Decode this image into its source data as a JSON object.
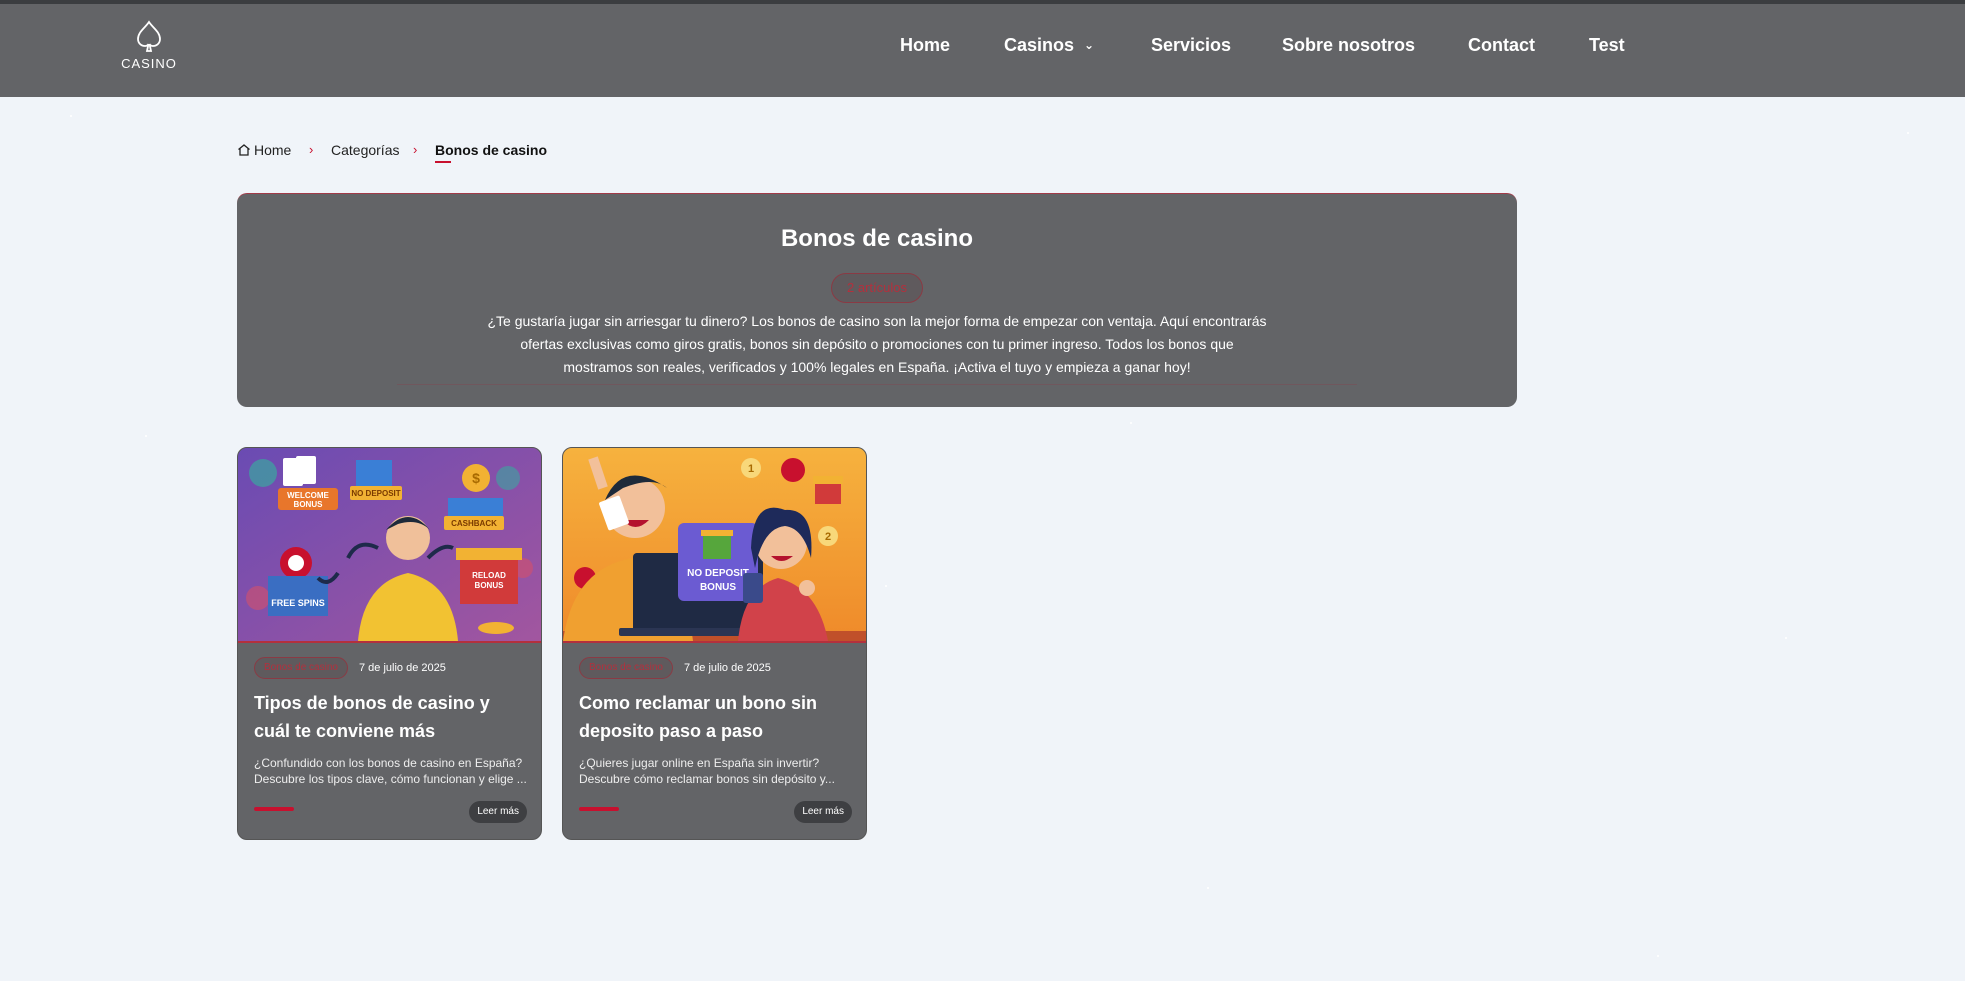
{
  "header": {
    "logo_text": "CASINO",
    "nav": [
      {
        "label": "Home"
      },
      {
        "label": "Casinos",
        "has_dropdown": true
      },
      {
        "label": "Servicios"
      },
      {
        "label": "Sobre nosotros"
      },
      {
        "label": "Contact"
      },
      {
        "label": "Test"
      }
    ]
  },
  "breadcrumb": {
    "home": "Home",
    "categories": "Categorías",
    "current": "Bonos de casino"
  },
  "hero": {
    "title": "Bonos de casino",
    "count": "2 artículos",
    "description": "¿Te gustaría jugar sin arriesgar tu dinero? Los bonos de casino son la mejor forma de empezar con ventaja. Aquí encontrarás ofertas exclusivas como giros gratis, bonos sin depósito o promociones con tu primer ingreso. Todos los bonos que mostramos son reales, verificados y 100% legales en España. ¡Activa el tuyo y empieza a ganar hoy!"
  },
  "articles": [
    {
      "category": "Bonos de casino",
      "date": "7 de julio de 2025",
      "title": "Tipos de bonos de casino y cuál te conviene más",
      "excerpt": "¿Confundido con los bonos de casino en España? Descubre los tipos clave, cómo funcionan y elige ...",
      "read_more": "Leer más",
      "image_labels": [
        "WELCOME BONUS",
        "NO DEPOSIT",
        "CASHBACK",
        "FREE SPINS",
        "RELOAD BONUS"
      ]
    },
    {
      "category": "Bonos de casino",
      "date": "7 de julio de 2025",
      "title": "Como reclamar un bono sin deposito paso a paso",
      "excerpt": "¿Quieres jugar online en España sin invertir? Descubre cómo reclamar bonos sin depósito y...",
      "read_more": "Leer más",
      "image_labels": [
        "NO DEPOSIT BONUS",
        "1",
        "2"
      ]
    }
  ],
  "colors": {
    "header_bg": "#636467",
    "accent": "#c8102e",
    "page_bg": "#f0f4f9"
  }
}
